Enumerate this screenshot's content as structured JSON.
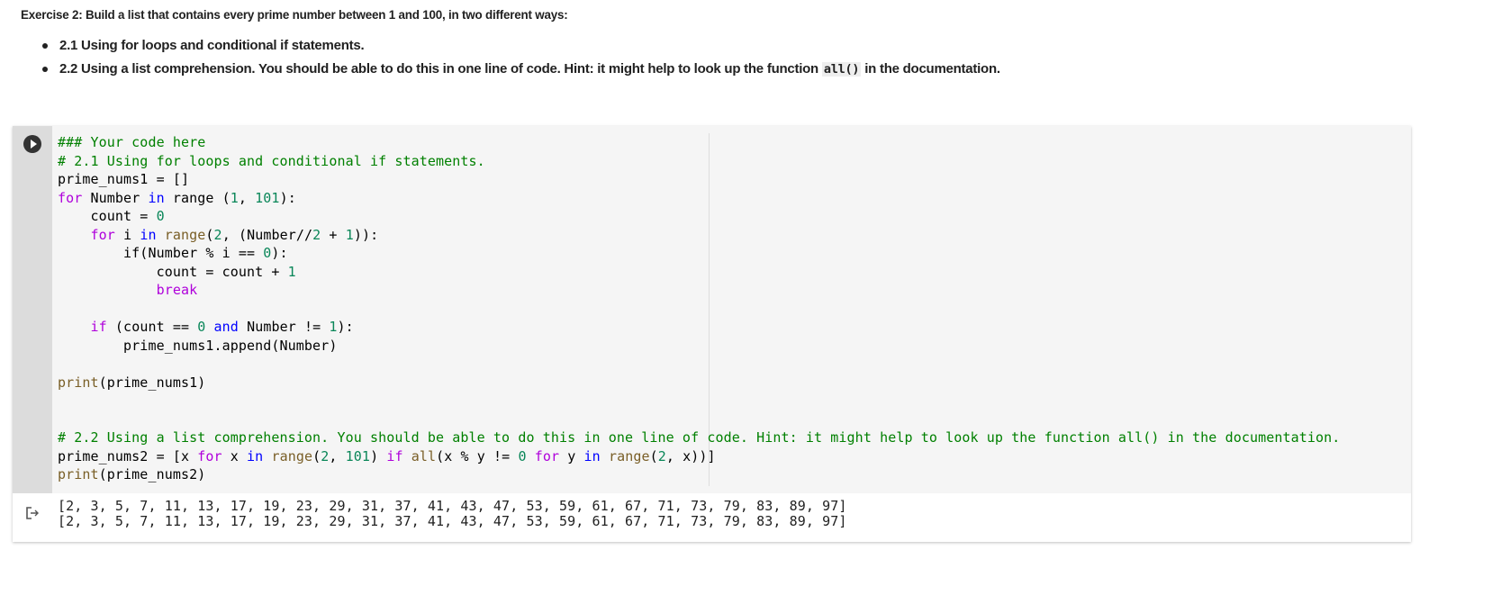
{
  "markdown": {
    "title": "Exercise 2: Build a list that contains every prime number between 1 and 100, in two different ways:",
    "bullets": [
      {
        "text": "2.1 Using for loops and conditional if statements."
      },
      {
        "text_before": "2.2 Using a list comprehension. You should be able to do this in one line of code. Hint: it might help to look up the function ",
        "code": "all()",
        "text_after": " in the documentation."
      }
    ]
  },
  "code_cell": {
    "run_button": "play-icon",
    "lines": [
      [
        [
          "### Your code here",
          "comment"
        ]
      ],
      [
        [
          "# 2.1 Using for loops and conditional if statements.",
          "comment"
        ]
      ],
      [
        [
          "prime_nums1 = []",
          ""
        ]
      ],
      [
        [
          "for",
          "kw"
        ],
        [
          " Number ",
          ""
        ],
        [
          "in",
          "in"
        ],
        [
          " range (",
          ""
        ],
        [
          "1",
          "num"
        ],
        [
          ", ",
          ""
        ],
        [
          "101",
          "num"
        ],
        [
          "):",
          ""
        ]
      ],
      [
        [
          "    count = ",
          ""
        ],
        [
          "0",
          "num"
        ]
      ],
      [
        [
          "    ",
          ""
        ],
        [
          "for",
          "kw"
        ],
        [
          " i ",
          ""
        ],
        [
          "in",
          "in"
        ],
        [
          " ",
          ""
        ],
        [
          "range",
          "fn"
        ],
        [
          "(",
          ""
        ],
        [
          "2",
          "num"
        ],
        [
          ", (Number//",
          ""
        ],
        [
          "2",
          "num"
        ],
        [
          " + ",
          ""
        ],
        [
          "1",
          "num"
        ],
        [
          ")):",
          ""
        ]
      ],
      [
        [
          "        if(Number % i == ",
          ""
        ],
        [
          "0",
          "num"
        ],
        [
          "):",
          ""
        ]
      ],
      [
        [
          "            count = count + ",
          ""
        ],
        [
          "1",
          "num"
        ]
      ],
      [
        [
          "            ",
          ""
        ],
        [
          "break",
          "kw"
        ]
      ],
      [],
      [
        [
          "    ",
          ""
        ],
        [
          "if",
          "kw"
        ],
        [
          " (count == ",
          ""
        ],
        [
          "0",
          "num"
        ],
        [
          " ",
          ""
        ],
        [
          "and",
          "in"
        ],
        [
          " Number != ",
          ""
        ],
        [
          "1",
          "num"
        ],
        [
          "):",
          ""
        ]
      ],
      [
        [
          "        prime_nums1.append(Number)",
          ""
        ]
      ],
      [],
      [
        [
          "print",
          "fn"
        ],
        [
          "(prime_nums1)",
          ""
        ]
      ],
      [],
      [],
      [
        [
          "# 2.2 Using a list comprehension. You should be able to do this in one line of code. Hint: it might help to look up the function all() in the documentation.",
          "comment"
        ]
      ],
      [
        [
          "prime_nums2 = [x ",
          ""
        ],
        [
          "for",
          "kw"
        ],
        [
          " x ",
          ""
        ],
        [
          "in",
          "in"
        ],
        [
          " ",
          ""
        ],
        [
          "range",
          "fn"
        ],
        [
          "(",
          ""
        ],
        [
          "2",
          "num"
        ],
        [
          ", ",
          ""
        ],
        [
          "101",
          "num"
        ],
        [
          ") ",
          ""
        ],
        [
          "if",
          "kw"
        ],
        [
          " ",
          ""
        ],
        [
          "all",
          "fn"
        ],
        [
          "(x % y != ",
          ""
        ],
        [
          "0",
          "num"
        ],
        [
          " ",
          ""
        ],
        [
          "for",
          "kw"
        ],
        [
          " y ",
          ""
        ],
        [
          "in",
          "in"
        ],
        [
          " ",
          ""
        ],
        [
          "range",
          "fn"
        ],
        [
          "(",
          ""
        ],
        [
          "2",
          "num"
        ],
        [
          ", x))]",
          ""
        ]
      ],
      [
        [
          "print",
          "fn"
        ],
        [
          "(prime_nums2)",
          ""
        ]
      ]
    ]
  },
  "output": {
    "icon": "output-redirect-icon",
    "lines": [
      "[2, 3, 5, 7, 11, 13, 17, 19, 23, 29, 31, 37, 41, 43, 47, 53, 59, 61, 67, 71, 73, 79, 83, 89, 97]",
      "[2, 3, 5, 7, 11, 13, 17, 19, 23, 29, 31, 37, 41, 43, 47, 53, 59, 61, 67, 71, 73, 79, 83, 89, 97]"
    ]
  },
  "colors": {
    "comment": "#008000",
    "keyword": "#af00db",
    "in": "#0000ff",
    "number": "#098658",
    "builtin": "#795e26"
  }
}
